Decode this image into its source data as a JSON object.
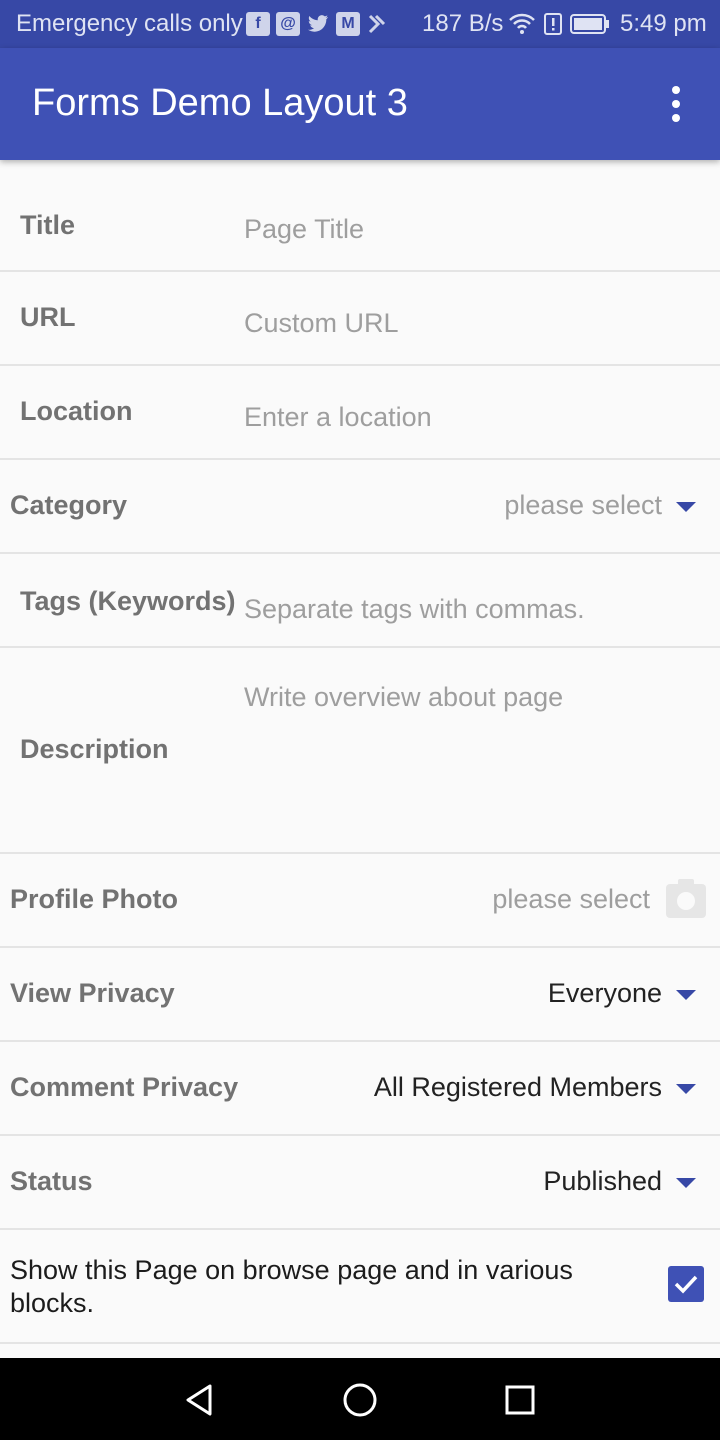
{
  "status_bar": {
    "carrier": "Emergency calls only",
    "notification_icons": [
      "facebook-icon",
      "app-icon",
      "twitter-icon",
      "gmail-icon",
      "message-icon"
    ],
    "network_speed": "187 B/s",
    "time": "5:49 pm"
  },
  "app_bar": {
    "title": "Forms Demo Layout 3",
    "overflow_icon": "more-vert-icon"
  },
  "form": {
    "title": {
      "label": "Title",
      "placeholder": "Page Title"
    },
    "url": {
      "label": "URL",
      "placeholder": "Custom URL"
    },
    "location": {
      "label": "Location",
      "placeholder": "Enter a location"
    },
    "category": {
      "label": "Category",
      "value": "please select"
    },
    "tags": {
      "label": "Tags (Keywords)",
      "placeholder": "Separate tags with commas."
    },
    "description": {
      "label": "Description",
      "placeholder": "Write overview about page"
    },
    "profile_photo": {
      "label": "Profile Photo",
      "value": "please select",
      "icon": "camera-icon"
    },
    "view_privacy": {
      "label": "View Privacy",
      "value": "Everyone"
    },
    "comment_privacy": {
      "label": "Comment Privacy",
      "value": "All Registered Members"
    },
    "status": {
      "label": "Status",
      "value": "Published"
    },
    "show_on_browse": {
      "label": "Show this Page on browse page and in various blocks.",
      "checked": true
    }
  },
  "colors": {
    "primary": "#3f51b5",
    "primary_dark": "#3748a6",
    "label": "#727272",
    "hint": "#9e9e9e"
  },
  "nav_bar": {
    "buttons": [
      "back-icon",
      "home-icon",
      "recents-icon"
    ]
  }
}
